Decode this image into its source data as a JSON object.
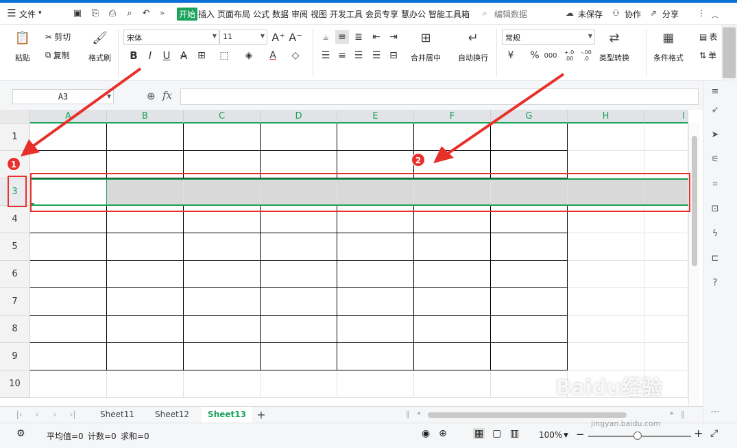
{
  "menubar": {
    "file_label": "文件",
    "tabs": [
      "开始",
      "插入",
      "页面布局",
      "公式",
      "数据",
      "审阅",
      "视图",
      "开发工具",
      "会员专享",
      "慧办公",
      "智能工具箱"
    ],
    "search_label": "编辑数据",
    "unsaved_label": "未保存",
    "collab_label": "协作",
    "share_label": "分享",
    "more_label": "»"
  },
  "ribbon": {
    "paste": "粘贴",
    "cut": "剪切",
    "copy": "复制",
    "format_painter": "格式刷",
    "font_name": "宋体",
    "font_size": "11",
    "merge_center": "合并居中",
    "wrap_text": "自动换行",
    "number_format": "常规",
    "type_convert": "类型转换",
    "cond_format": "条件格式",
    "table_style": "表",
    "single": "单",
    "currency_symbol": "¥",
    "percent_symbol": "%",
    "thousands_symbol": "000",
    "inc_decimal": "+.0\n.00",
    "dec_decimal": "-.00\n.0"
  },
  "formula": {
    "name_box": "A3",
    "fx_label": "fx",
    "value": ""
  },
  "grid": {
    "columns": [
      "A",
      "B",
      "C",
      "D",
      "E",
      "F",
      "G",
      "H",
      "I"
    ],
    "rows": [
      "1",
      "2",
      "3",
      "4",
      "5",
      "6",
      "7",
      "8",
      "9",
      "10"
    ],
    "selected_row": "3",
    "active_cell": "A3"
  },
  "sheets": {
    "tabs": [
      "Sheet11",
      "Sheet12",
      "Sheet13"
    ],
    "active": "Sheet13",
    "add": "+"
  },
  "status": {
    "average": "平均值=0",
    "count": "计数=0",
    "sum": "求和=0",
    "zoom": "100%",
    "zoom_minus": "−",
    "zoom_plus": "+"
  },
  "annotations": {
    "badge1": "1",
    "badge2": "2",
    "color": "#e8302b"
  },
  "watermark": {
    "brand": "Baidu经验",
    "url": "jingyan.baidu.com"
  }
}
